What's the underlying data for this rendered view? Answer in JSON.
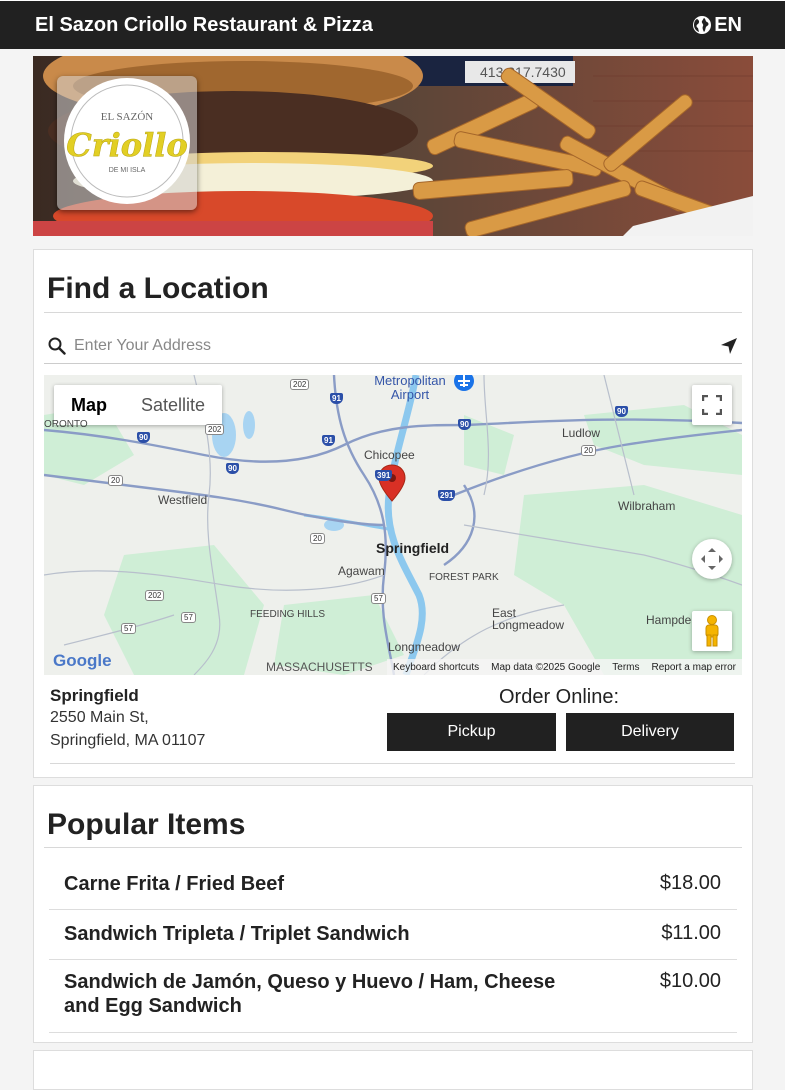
{
  "header": {
    "title": "El Sazon Criollo Restaurant & Pizza",
    "language": "EN",
    "language_icon": "globe-icon"
  },
  "hero": {
    "phone_sign": "413.317.7430",
    "logo": {
      "top": "EL SAZÓN",
      "main": "Criollo",
      "bottom": "DE MI ISLA"
    }
  },
  "location_finder": {
    "heading": "Find a Location",
    "search_placeholder": "Enter Your Address",
    "map": {
      "type_buttons": [
        "Map",
        "Satellite"
      ],
      "active_type": "Map",
      "labels": {
        "springfield": "Springfield",
        "chicopee": "Chicopee",
        "westfield": "Westfield",
        "agawam": "Agawam",
        "forest_park": "FOREST PARK",
        "feeding_hills": "FEEDING HILLS",
        "longmeadow": "Longmeadow",
        "east_longmeadow": "East Longmeadow",
        "wilbraham": "Wilbraham",
        "ludlow": "Ludlow",
        "hampden": "Hampde",
        "airport": "Metropolitan Airport",
        "toronto": "ORONTO",
        "massachusetts": "MASSACHUSETTS",
        "google": "Google"
      },
      "shields": {
        "i90": "90",
        "i91": "91",
        "i391": "391",
        "i291": "291",
        "us20": "20",
        "us202": "202",
        "us57": "57"
      },
      "footer": {
        "shortcuts": "Keyboard shortcuts",
        "data": "Map data ©2025 Google",
        "terms": "Terms",
        "report": "Report a map error"
      }
    },
    "location": {
      "name": "Springfield",
      "street": "2550 Main St,",
      "city_line": "Springfield, MA 01107"
    },
    "order": {
      "label": "Order Online:",
      "pickup": "Pickup",
      "delivery": "Delivery"
    }
  },
  "popular": {
    "heading": "Popular Items",
    "items": [
      {
        "name": "Carne Frita / Fried Beef",
        "price": "$18.00"
      },
      {
        "name": "Sandwich Tripleta / Triplet Sandwich",
        "price": "$11.00"
      },
      {
        "name": "Sandwich de Jamón, Queso y Huevo / Ham, Cheese and Egg Sandwich",
        "price": "$10.00"
      }
    ]
  },
  "colors": {
    "header_bg": "#212121",
    "button_bg": "#212121",
    "pin": "#d93025"
  }
}
